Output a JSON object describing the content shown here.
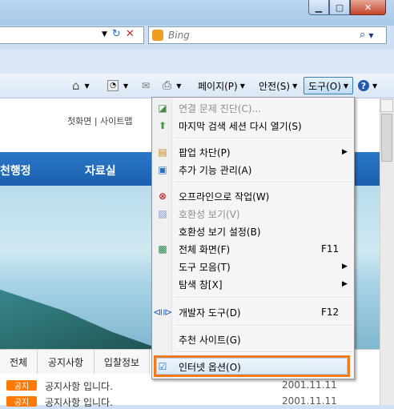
{
  "search": {
    "placeholder": "Bing"
  },
  "command_bar": {
    "page": "페이지(P)",
    "safety": "안전(S)",
    "tools": "도구(O)"
  },
  "webpage": {
    "top_links": "첫화면  |  사이트맵",
    "nav": [
      "천행정",
      "자료실"
    ],
    "tabs": [
      "전체",
      "공지사항",
      "입찰정보"
    ],
    "notices": [
      {
        "badge": "공지",
        "text": "공지사항 입니다.",
        "date": "2001.11.11"
      },
      {
        "badge": "공지",
        "text": "공지사항 입니다.",
        "date": "2001.11.11"
      }
    ]
  },
  "menu": {
    "items": [
      {
        "label": "연결 문제 진단(C)...",
        "icon": "diagnose-icon",
        "disabled": true
      },
      {
        "label": "마지막 검색 세션 다시 열기(S)",
        "icon": "reopen-icon"
      },
      {
        "label": "팝업 차단(P)",
        "icon": "popup-icon",
        "submenu": true
      },
      {
        "label": "추가 기능 관리(A)",
        "icon": "addons-icon"
      },
      {
        "label": "오프라인으로 작업(W)",
        "icon": "offline-icon"
      },
      {
        "label": "호환성 보기(V)",
        "icon": "compat-icon",
        "disabled": true
      },
      {
        "label": "호환성 보기 설정(B)",
        "icon": ""
      },
      {
        "label": "전체 화면(F)",
        "shortcut": "F11",
        "icon": "fullscreen-icon"
      },
      {
        "label": "도구 모음(T)",
        "icon": "",
        "submenu": true
      },
      {
        "label": "탐색 창[X]",
        "icon": "",
        "submenu": true
      },
      {
        "label": "개발자 도구(D)",
        "shortcut": "F12",
        "icon": "devtools-icon"
      },
      {
        "label": "추천 사이트(G)",
        "icon": ""
      },
      {
        "label": "인터넷 옵션(O)",
        "icon": "internet-options-icon"
      }
    ]
  }
}
